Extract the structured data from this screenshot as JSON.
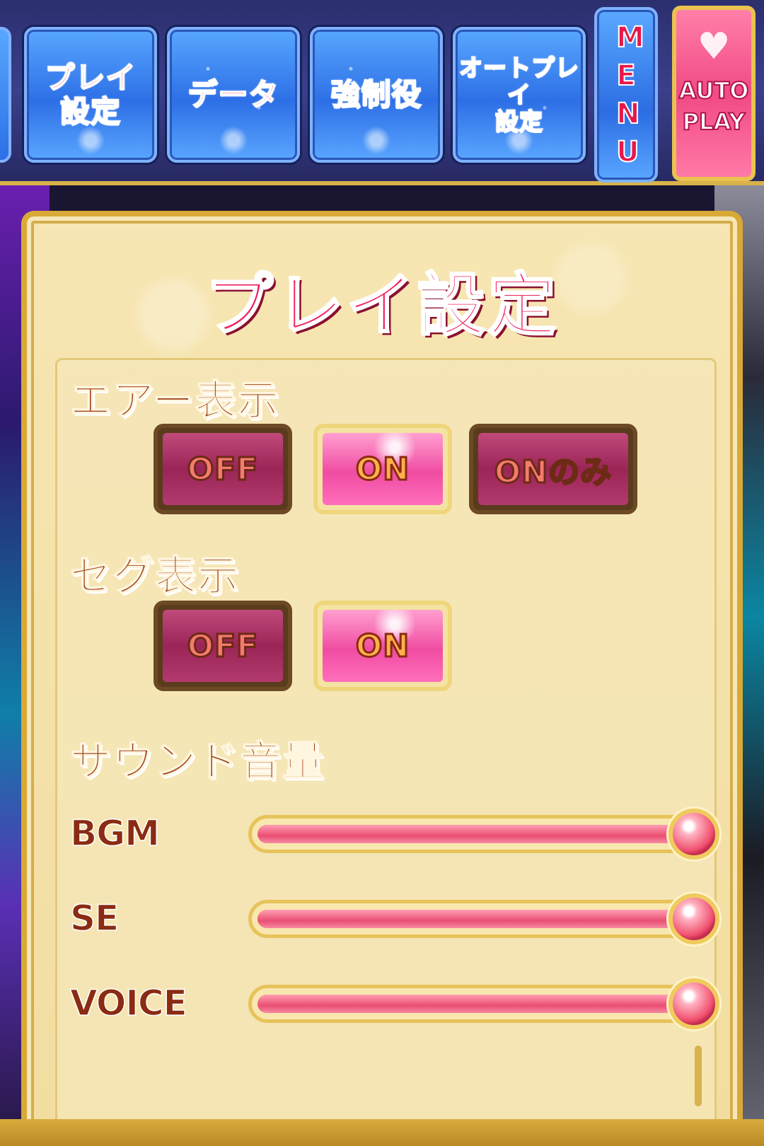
{
  "toolbar": {
    "buttons": [
      {
        "label": "プレイ\n設定"
      },
      {
        "label": "データ"
      },
      {
        "label": "強制役"
      },
      {
        "label": "オートプレイ\n設定"
      }
    ],
    "menu_label": "MENU",
    "auto_play_label": "AUTO\nPLAY"
  },
  "panel": {
    "title": "プレイ設定",
    "air_display": {
      "label": "エアー表示",
      "options": [
        "OFF",
        "ON",
        "ONのみ"
      ],
      "selected": "ON"
    },
    "seg_display": {
      "label": "セグ表示",
      "options": [
        "OFF",
        "ON"
      ],
      "selected": "ON"
    },
    "sound": {
      "label": "サウンド音量",
      "sliders": [
        {
          "label": "BGM",
          "value": 1.0
        },
        {
          "label": "SE",
          "value": 1.0
        },
        {
          "label": "VOICE",
          "value": 1.0
        }
      ]
    }
  },
  "colors": {
    "accent_pink": "#f0225f",
    "toolbar_blue": "#2d6fe6",
    "gold_frame": "#d9a938",
    "label_brown": "#a0431a"
  }
}
